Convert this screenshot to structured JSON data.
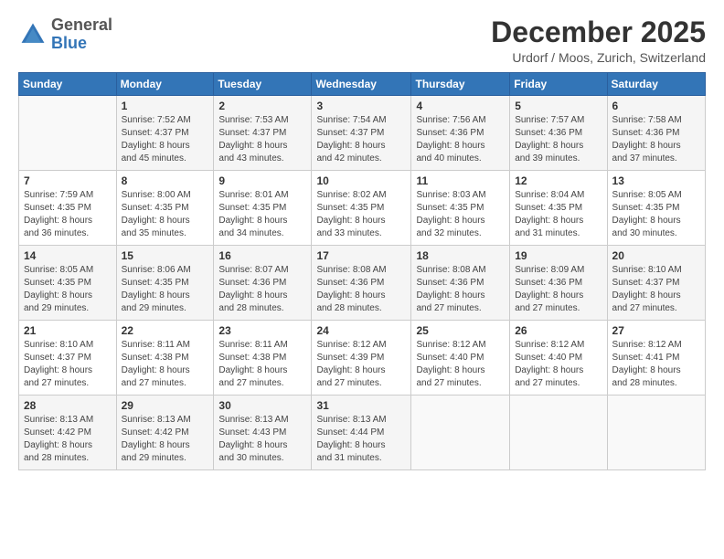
{
  "header": {
    "logo": {
      "general": "General",
      "blue": "Blue"
    },
    "title": "December 2025",
    "subtitle": "Urdorf / Moos, Zurich, Switzerland"
  },
  "days_of_week": [
    "Sunday",
    "Monday",
    "Tuesday",
    "Wednesday",
    "Thursday",
    "Friday",
    "Saturday"
  ],
  "weeks": [
    [
      {
        "day": "",
        "info": ""
      },
      {
        "day": "1",
        "info": "Sunrise: 7:52 AM\nSunset: 4:37 PM\nDaylight: 8 hours\nand 45 minutes."
      },
      {
        "day": "2",
        "info": "Sunrise: 7:53 AM\nSunset: 4:37 PM\nDaylight: 8 hours\nand 43 minutes."
      },
      {
        "day": "3",
        "info": "Sunrise: 7:54 AM\nSunset: 4:37 PM\nDaylight: 8 hours\nand 42 minutes."
      },
      {
        "day": "4",
        "info": "Sunrise: 7:56 AM\nSunset: 4:36 PM\nDaylight: 8 hours\nand 40 minutes."
      },
      {
        "day": "5",
        "info": "Sunrise: 7:57 AM\nSunset: 4:36 PM\nDaylight: 8 hours\nand 39 minutes."
      },
      {
        "day": "6",
        "info": "Sunrise: 7:58 AM\nSunset: 4:36 PM\nDaylight: 8 hours\nand 37 minutes."
      }
    ],
    [
      {
        "day": "7",
        "info": "Sunrise: 7:59 AM\nSunset: 4:35 PM\nDaylight: 8 hours\nand 36 minutes."
      },
      {
        "day": "8",
        "info": "Sunrise: 8:00 AM\nSunset: 4:35 PM\nDaylight: 8 hours\nand 35 minutes."
      },
      {
        "day": "9",
        "info": "Sunrise: 8:01 AM\nSunset: 4:35 PM\nDaylight: 8 hours\nand 34 minutes."
      },
      {
        "day": "10",
        "info": "Sunrise: 8:02 AM\nSunset: 4:35 PM\nDaylight: 8 hours\nand 33 minutes."
      },
      {
        "day": "11",
        "info": "Sunrise: 8:03 AM\nSunset: 4:35 PM\nDaylight: 8 hours\nand 32 minutes."
      },
      {
        "day": "12",
        "info": "Sunrise: 8:04 AM\nSunset: 4:35 PM\nDaylight: 8 hours\nand 31 minutes."
      },
      {
        "day": "13",
        "info": "Sunrise: 8:05 AM\nSunset: 4:35 PM\nDaylight: 8 hours\nand 30 minutes."
      }
    ],
    [
      {
        "day": "14",
        "info": "Sunrise: 8:05 AM\nSunset: 4:35 PM\nDaylight: 8 hours\nand 29 minutes."
      },
      {
        "day": "15",
        "info": "Sunrise: 8:06 AM\nSunset: 4:35 PM\nDaylight: 8 hours\nand 29 minutes."
      },
      {
        "day": "16",
        "info": "Sunrise: 8:07 AM\nSunset: 4:36 PM\nDaylight: 8 hours\nand 28 minutes."
      },
      {
        "day": "17",
        "info": "Sunrise: 8:08 AM\nSunset: 4:36 PM\nDaylight: 8 hours\nand 28 minutes."
      },
      {
        "day": "18",
        "info": "Sunrise: 8:08 AM\nSunset: 4:36 PM\nDaylight: 8 hours\nand 27 minutes."
      },
      {
        "day": "19",
        "info": "Sunrise: 8:09 AM\nSunset: 4:36 PM\nDaylight: 8 hours\nand 27 minutes."
      },
      {
        "day": "20",
        "info": "Sunrise: 8:10 AM\nSunset: 4:37 PM\nDaylight: 8 hours\nand 27 minutes."
      }
    ],
    [
      {
        "day": "21",
        "info": "Sunrise: 8:10 AM\nSunset: 4:37 PM\nDaylight: 8 hours\nand 27 minutes."
      },
      {
        "day": "22",
        "info": "Sunrise: 8:11 AM\nSunset: 4:38 PM\nDaylight: 8 hours\nand 27 minutes."
      },
      {
        "day": "23",
        "info": "Sunrise: 8:11 AM\nSunset: 4:38 PM\nDaylight: 8 hours\nand 27 minutes."
      },
      {
        "day": "24",
        "info": "Sunrise: 8:12 AM\nSunset: 4:39 PM\nDaylight: 8 hours\nand 27 minutes."
      },
      {
        "day": "25",
        "info": "Sunrise: 8:12 AM\nSunset: 4:40 PM\nDaylight: 8 hours\nand 27 minutes."
      },
      {
        "day": "26",
        "info": "Sunrise: 8:12 AM\nSunset: 4:40 PM\nDaylight: 8 hours\nand 27 minutes."
      },
      {
        "day": "27",
        "info": "Sunrise: 8:12 AM\nSunset: 4:41 PM\nDaylight: 8 hours\nand 28 minutes."
      }
    ],
    [
      {
        "day": "28",
        "info": "Sunrise: 8:13 AM\nSunset: 4:42 PM\nDaylight: 8 hours\nand 28 minutes."
      },
      {
        "day": "29",
        "info": "Sunrise: 8:13 AM\nSunset: 4:42 PM\nDaylight: 8 hours\nand 29 minutes."
      },
      {
        "day": "30",
        "info": "Sunrise: 8:13 AM\nSunset: 4:43 PM\nDaylight: 8 hours\nand 30 minutes."
      },
      {
        "day": "31",
        "info": "Sunrise: 8:13 AM\nSunset: 4:44 PM\nDaylight: 8 hours\nand 31 minutes."
      },
      {
        "day": "",
        "info": ""
      },
      {
        "day": "",
        "info": ""
      },
      {
        "day": "",
        "info": ""
      }
    ]
  ]
}
